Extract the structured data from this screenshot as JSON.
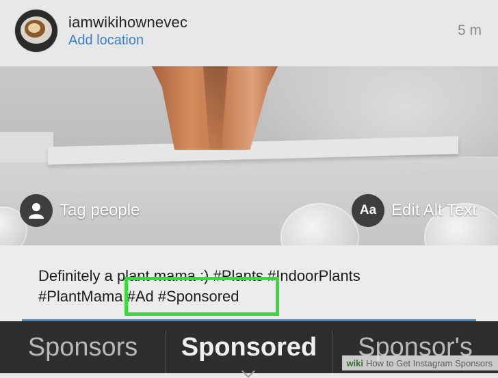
{
  "post": {
    "username": "iamwikihownevec",
    "location": "Add location",
    "time": "5 m"
  },
  "photo_actions": {
    "tag_people": "Tag people",
    "alt_icon_text": "Aa",
    "edit_alt_text": "Edit Alt Text"
  },
  "caption": {
    "line1": "Definitely a plant mama :) #Plants #IndoorPlants",
    "line2": "#PlantMama #Ad #Sponsored"
  },
  "suggestions": [
    "Sponsors",
    "Sponsored",
    "Sponsor's"
  ],
  "watermark": {
    "brand": "wiki",
    "text": "How to Get Instagram Sponsors"
  },
  "colors": {
    "highlight": "#3ad93a",
    "link": "#3f7fc6",
    "keyboard_bar": "#2e2e2e"
  }
}
